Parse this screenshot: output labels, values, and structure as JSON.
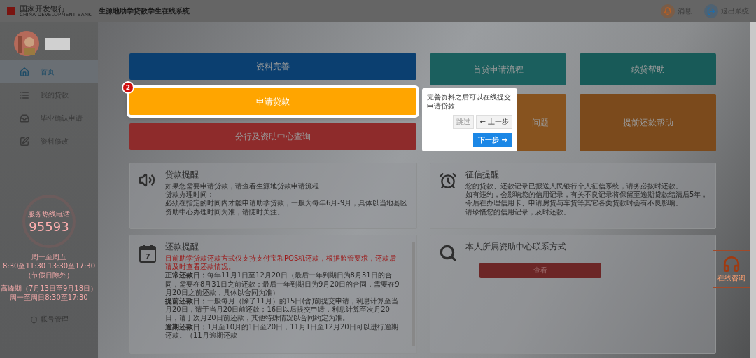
{
  "header": {
    "bank_name": "国家开发银行",
    "bank_name_en": "CHINA DEVELOPMENT BANK",
    "system_title": "生源地助学贷款学生在线系统",
    "actions": [
      {
        "label": "消息",
        "kind": "bell"
      },
      {
        "label": "退出系统",
        "kind": "logout"
      }
    ]
  },
  "sidebar": {
    "items": [
      {
        "label": "首页",
        "selected": true
      },
      {
        "label": "我的贷款",
        "selected": false
      },
      {
        "label": "毕业确认申请",
        "selected": false
      },
      {
        "label": "资料修改",
        "selected": false
      }
    ],
    "hotline": {
      "caption": "服务热线电话",
      "number": "95593",
      "hours": [
        "周一至周五",
        "8:30至11:30 13:30至17:30",
        "（节假日除外）"
      ],
      "peak": [
        "高峰期（7月13日至9月18日）",
        "周一至周日8:30至17:30"
      ]
    },
    "account_link": "帐号管理"
  },
  "primary_actions": [
    {
      "label": "资料完善",
      "color": "#0b3f70",
      "highlighted": false
    },
    {
      "label": "申请贷款",
      "color": "#ffa500",
      "highlighted": true
    },
    {
      "label": "分行及资助中心查询",
      "color": "#8e2b2b",
      "highlighted": false
    }
  ],
  "help_tiles": [
    {
      "label": "首贷申请流程",
      "color": "#1b5f5e"
    },
    {
      "label": "续贷帮助",
      "color": "#185a58"
    },
    {
      "label": "问题",
      "color": "#87531f"
    },
    {
      "label": "提前还款帮助",
      "color": "#7b4a1c"
    }
  ],
  "tour": {
    "step": "2",
    "text": "完善资料之后可以在线提交申请贷款",
    "buttons": [
      {
        "label": "跳过",
        "kind": "skip"
      },
      {
        "label": "← 上一步",
        "kind": "prev"
      },
      {
        "label": "下一步 →",
        "kind": "next"
      }
    ]
  },
  "cards": [
    {
      "kind": "text",
      "title": "贷款提醒",
      "paragraphs": [
        "如果您需要申请贷款，请查看生源地贷款申请流程",
        "贷款办理时间：",
        "必须在指定的时间内才能申请助学贷款，一般为每年6月-9月，具体以当地县区资助中心办理时间为准，请随时关注。"
      ]
    },
    {
      "kind": "text",
      "title": "征信提醒",
      "paragraphs": [
        "您的贷款、还款记录已报送人民银行个人征信系统，请务必按时还款。",
        "如有违约，会影响您的信用记录，有关不良记录将保留至逾期贷款结清后5年，今后在办理信用卡、申请房贷与车贷等其它各类贷款时会有不良影响。",
        "请珍惜您的信用记录，及时还款。"
      ]
    },
    {
      "kind": "scroll",
      "calendar_day": "7",
      "title": "还款提醒",
      "notice": "目前助学贷款还款方式仅支持支付宝和POS机还款，根据监管要求，还款后请及时查看还款情况。",
      "paragraphs": [
        "**正常还款日：**每年11月1日至12月20日（最后一年到期日为8月31日的合同，需要在8月31日之前还款；最后一年到期日为9月20日的合同，需要在9月20日之前还款，具体以合同为准）",
        "**提前还款日：**一般每月（除了11月）的15日(含)前提交申请，利息计算至当月20日，请于当月20日前还款；16日以后提交申请，利息计算至次月20日，请于次月20日前还款；其他特殊情况以合同约定为准。",
        "**逾期还款日：**1月至10月的1日至20日，11月1日至12月20日可以进行逾期还款。（11月逾期还款"
      ]
    },
    {
      "kind": "button",
      "title": "本人所属资助中心联系方式",
      "button": "查看"
    }
  ],
  "consult": {
    "label": "在线咨询"
  }
}
